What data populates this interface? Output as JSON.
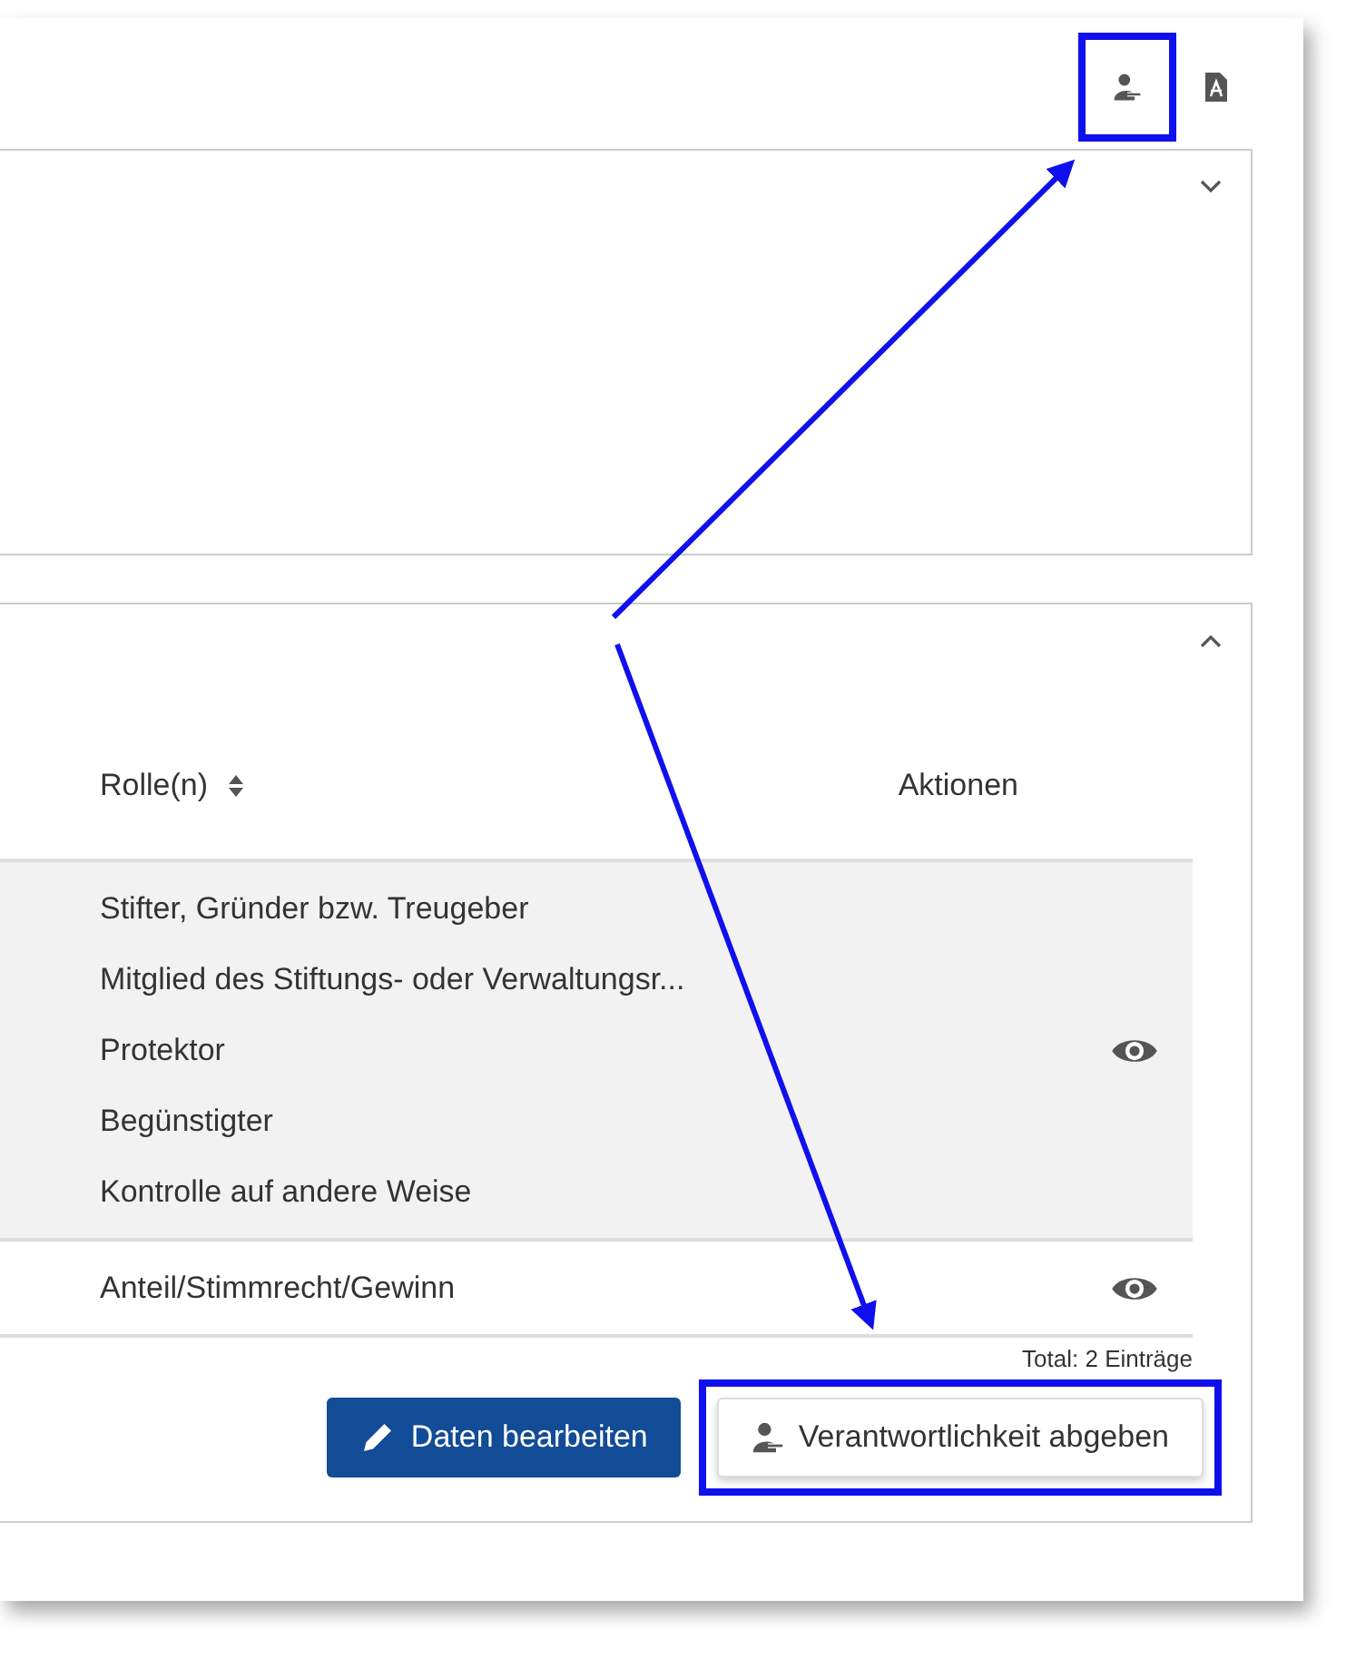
{
  "toolbar": {
    "icons": [
      {
        "kind": "user-transfer",
        "highlighted": true
      },
      {
        "kind": "pdf",
        "highlighted": false
      }
    ]
  },
  "panels": [
    {
      "kind": "empty",
      "expanded": false
    },
    {
      "kind": "table",
      "expanded": true,
      "table": {
        "columns": [
          {
            "label": "Rolle(n)",
            "sortable": true
          },
          {
            "label": "Aktionen",
            "sortable": false
          }
        ],
        "rows": [
          {
            "selected": true,
            "roles": [
              "Stifter, Gründer bzw. Treugeber",
              "Mitglied des Stiftungs- oder Verwaltungsr...",
              "Protektor",
              "Begünstigter",
              "Kontrolle auf andere Weise"
            ]
          },
          {
            "selected": false,
            "roles": [
              "Anteil/Stimmrecht/Gewinn"
            ]
          }
        ],
        "total": "Total: 2 Einträge"
      },
      "buttons": [
        {
          "kind": "primary",
          "label": "Daten bearbeiten",
          "highlighted": false
        },
        {
          "kind": "secondary",
          "label": "Verantwortlichkeit abgeben",
          "highlighted": true
        }
      ]
    }
  ]
}
